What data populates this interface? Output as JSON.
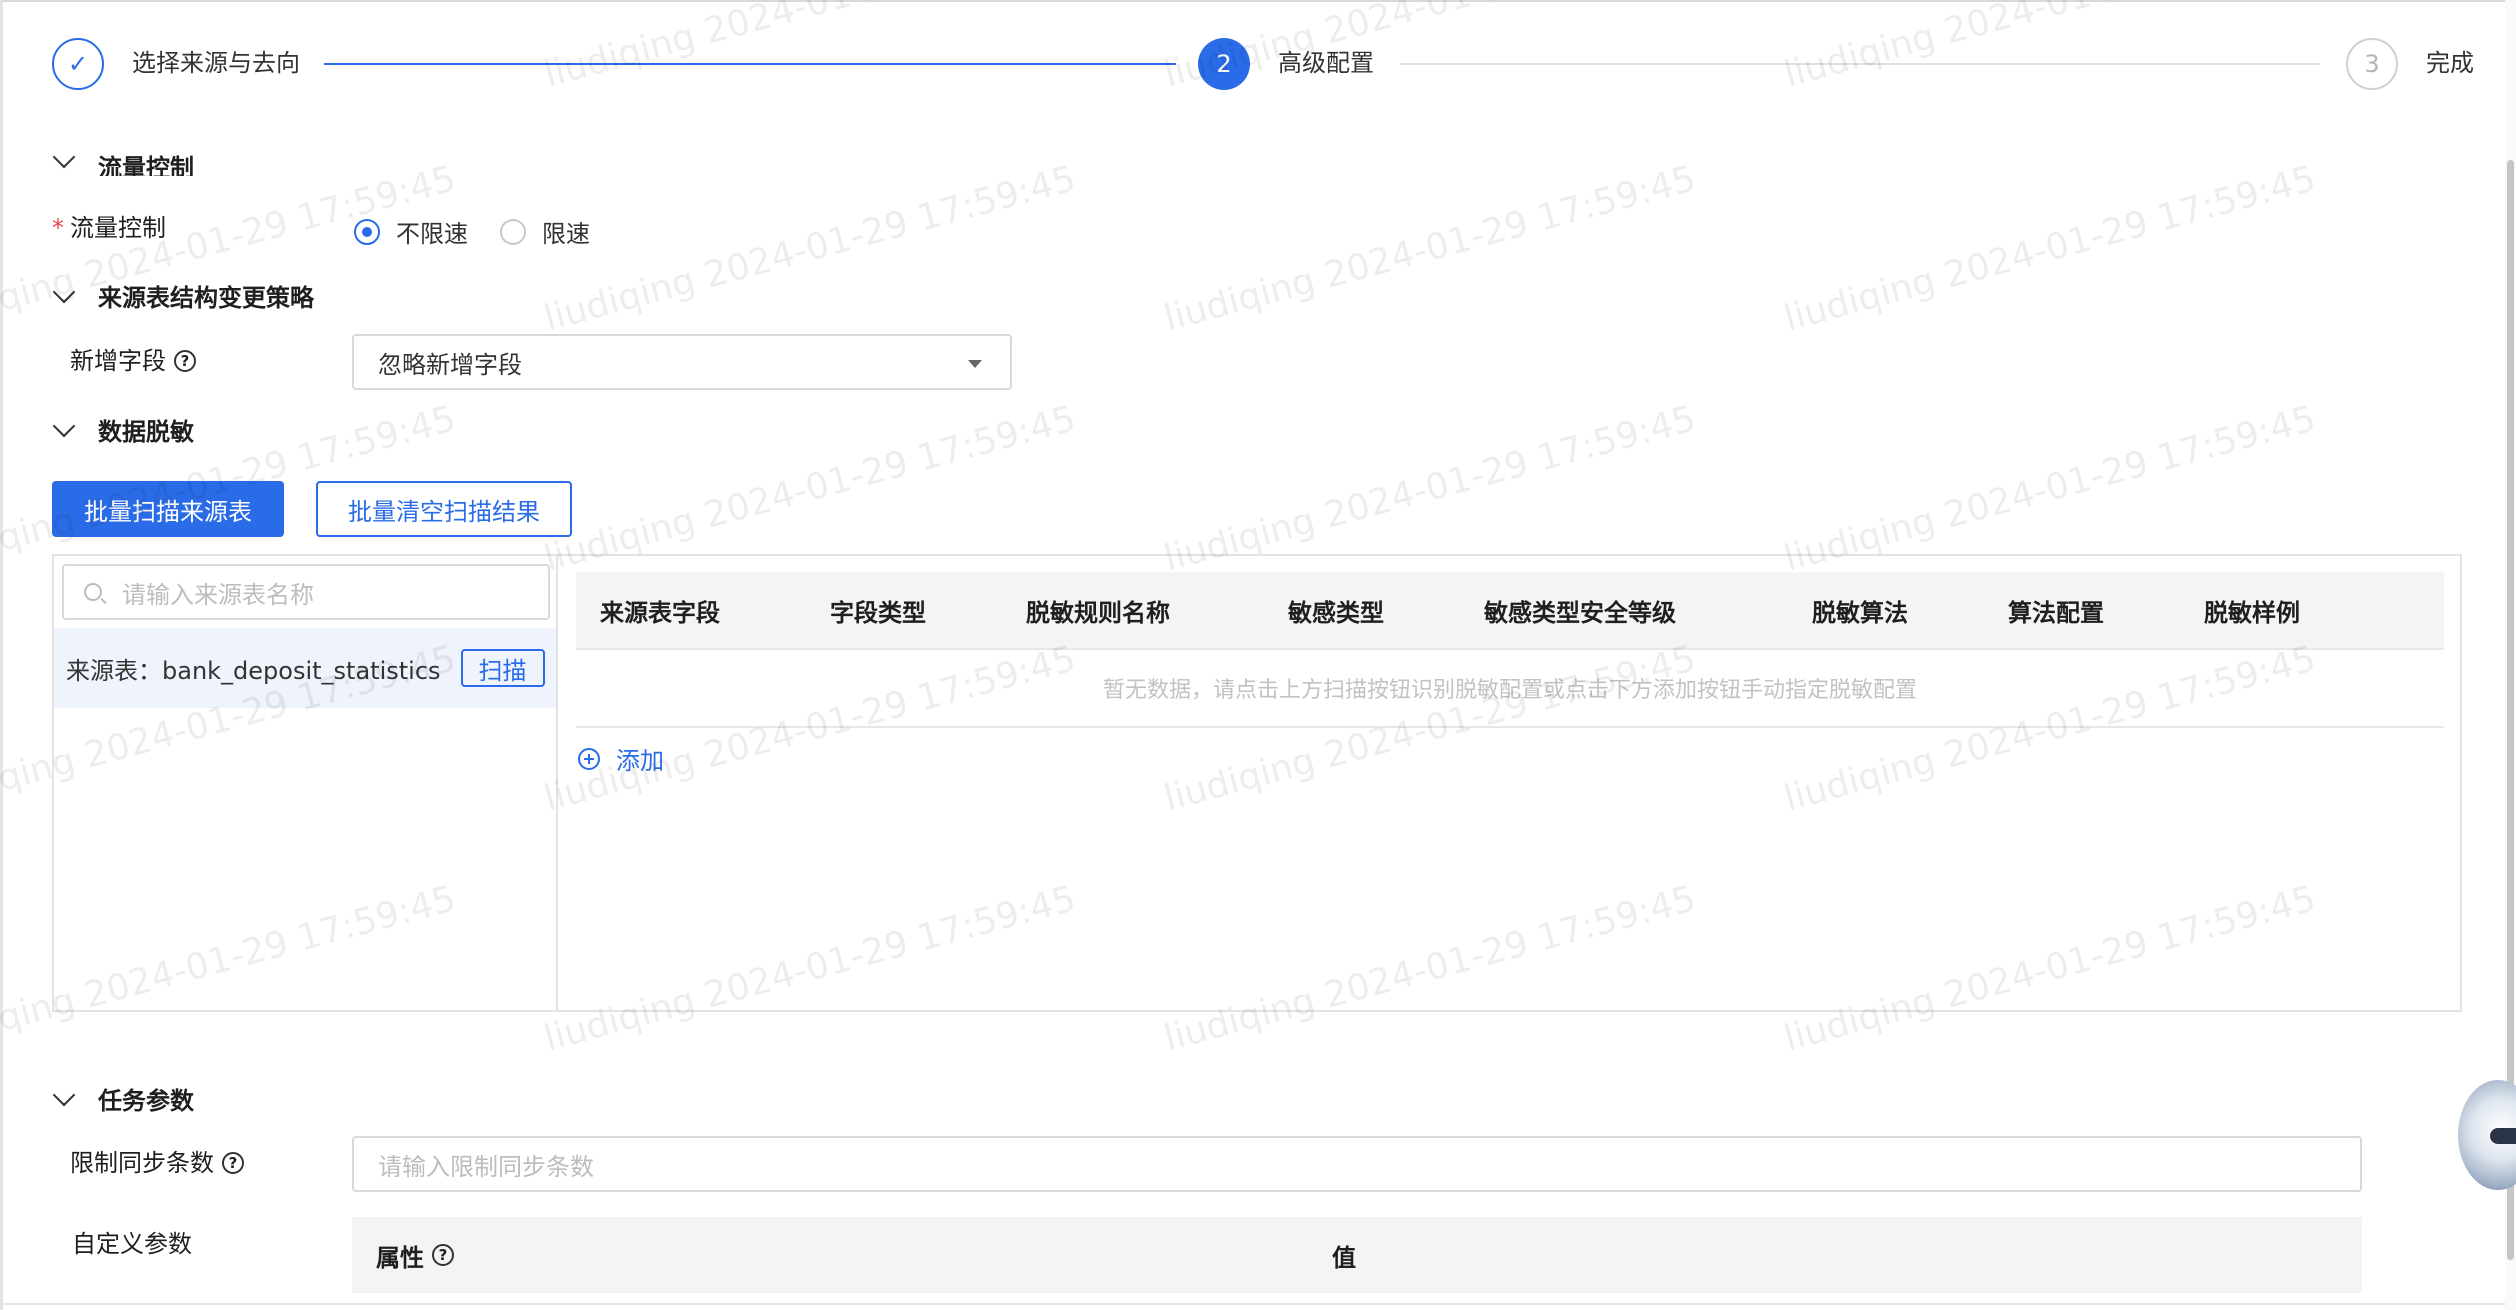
{
  "steps": [
    {
      "index": "✓",
      "label": "选择来源与去向",
      "state": "done"
    },
    {
      "index": "2",
      "label": "高级配置",
      "state": "active"
    },
    {
      "index": "3",
      "label": "完成",
      "state": "wait"
    }
  ],
  "flow_control": {
    "section_title": "流量控制",
    "label": "流量控制",
    "options": [
      "不限速",
      "限速"
    ],
    "selected": "不限速"
  },
  "schema_change": {
    "section_title": "来源表结构变更策略",
    "new_field_label": "新增字段",
    "new_field_value": "忽略新增字段"
  },
  "masking": {
    "section_title": "数据脱敏",
    "batch_scan_label": "批量扫描来源表",
    "batch_clear_label": "批量清空扫描结果",
    "search_placeholder": "请输入来源表名称",
    "source_tables": [
      {
        "label": "来源表：bank_deposit_statistics",
        "action": "扫描"
      }
    ],
    "columns": [
      "来源表字段",
      "字段类型",
      "脱敏规则名称",
      "敏感类型",
      "敏感类型安全等级",
      "脱敏算法",
      "算法配置",
      "脱敏样例"
    ],
    "empty_text": "暂无数据，请点击上方扫描按钮识别脱敏配置或点击下方添加按钮手动指定脱敏配置",
    "add_label": "添加"
  },
  "task_params": {
    "section_title": "任务参数",
    "limit_label": "限制同步条数",
    "limit_placeholder": "请输入限制同步条数",
    "custom_label": "自定义参数",
    "custom_columns": [
      "属性",
      "值"
    ]
  },
  "watermark": "liudiqing 2024-01-29 17:59:45",
  "colors": {
    "primary": "#2a6ce8",
    "required": "#e5484d"
  }
}
